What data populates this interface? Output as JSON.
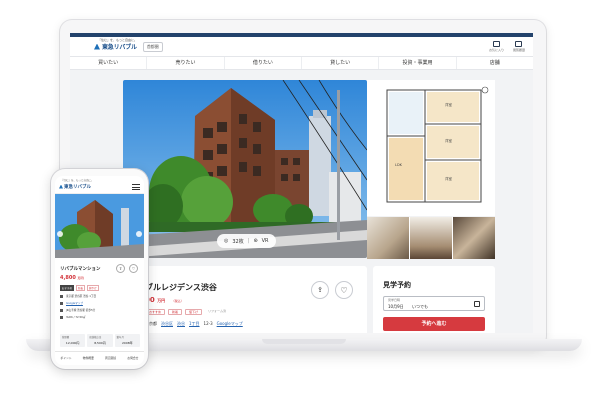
{
  "header": {
    "tagline": "『住む』を、もっと自由に。",
    "logo_text": "東急リバブル",
    "region": "首都圏",
    "icons": [
      {
        "icon": "heart-chat-icon",
        "label": "お気に入り"
      },
      {
        "icon": "history-icon",
        "label": "閲覧履歴"
      }
    ]
  },
  "nav": [
    "買いたい",
    "売りたい",
    "借りたい",
    "貸したい",
    "投資・事業用",
    "店舗"
  ],
  "gallery": {
    "photo_count": "32枚",
    "vr_label": "VR"
  },
  "property": {
    "name": "リバブルレジデンス渋谷",
    "name_partial": "ブルレジデンス渋谷",
    "price": "4,800",
    "price_partial": "00",
    "price_unit": "万円",
    "tax_note": "（税込）",
    "tags": [
      "おすすめ",
      "新着",
      "値下げ",
      "リフォーム済"
    ],
    "address_parts": [
      "東京都",
      "渋谷区",
      "渋谷",
      "1丁目",
      "12-3",
      "Googleマップ"
    ]
  },
  "booking": {
    "title": "見学予約",
    "field_label": "見学日時",
    "date": "10月9日",
    "time": "いつでも",
    "button": "予約へ進む"
  },
  "phone": {
    "tagline": "『住む』を、もっと自由に。",
    "logo_text": "東急リバブル",
    "name": "リバブルマンション",
    "price": "4,800",
    "price_unit": "万円",
    "tags": [
      "おすすめ",
      "新着",
      "値下げ"
    ],
    "rows": [
      {
        "k": "所在地",
        "v": "東京都 渋谷区 渋谷 1丁目",
        "link": false
      },
      {
        "k": "Googleマップ",
        "v": "Googleマップ",
        "link": true
      },
      {
        "k": "交通",
        "v": "JR山手線 渋谷駅 徒歩5分",
        "link": false
      },
      {
        "k": "間取り",
        "v": "3LDK / 72.50㎡",
        "link": false
      }
    ],
    "stats": [
      {
        "a": "管理費",
        "b": "12,000円"
      },
      {
        "a": "修繕積立金",
        "b": "8,500円"
      },
      {
        "a": "築年月",
        "b": "2008年"
      }
    ],
    "tabs": [
      "ポイント",
      "物件概要",
      "周辺環境",
      "お問合せ"
    ]
  }
}
